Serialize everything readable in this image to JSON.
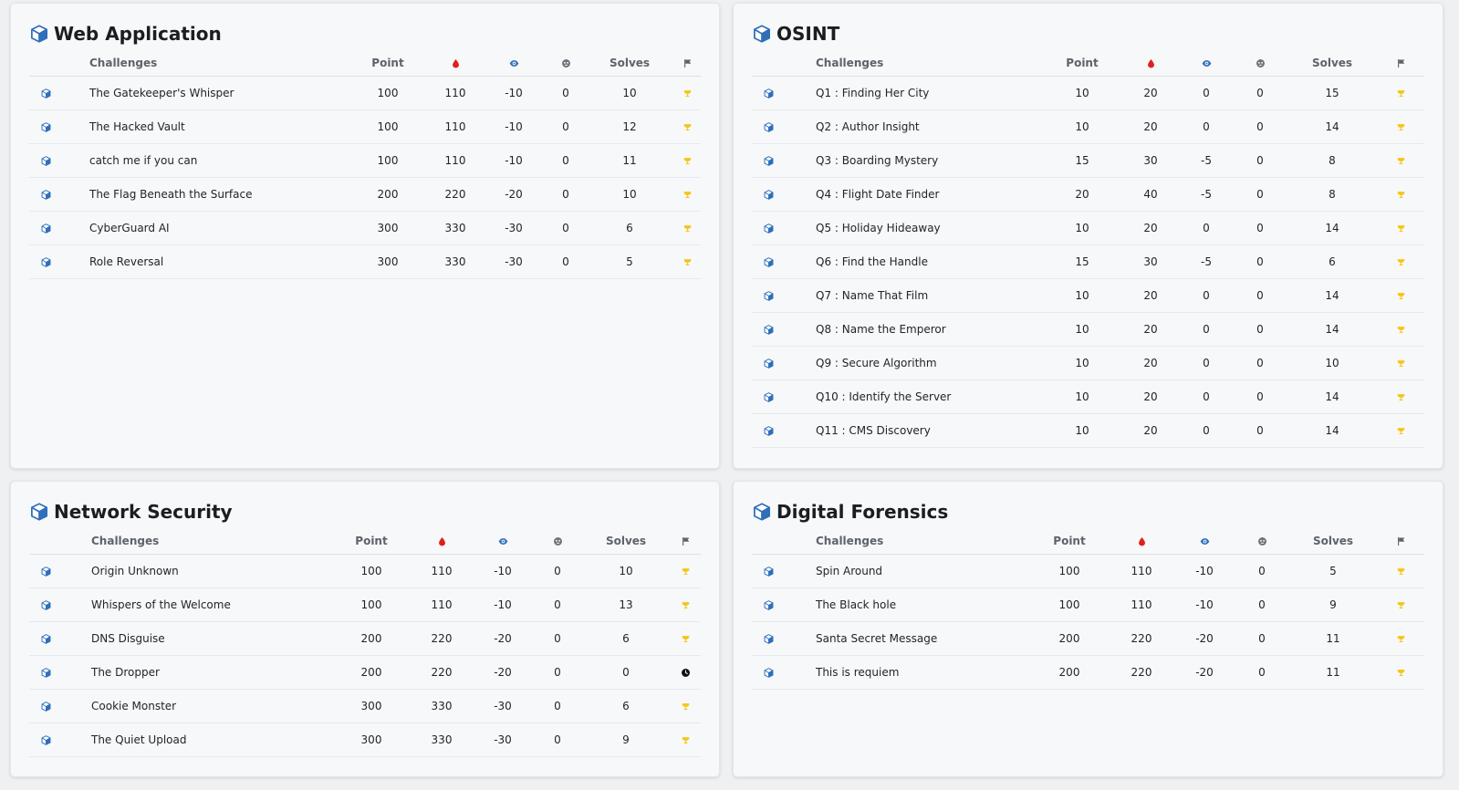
{
  "colors": {
    "cube": "#2f6fba",
    "blood": "#e0201c",
    "eye": "#2f6fba",
    "ghost": "#6c757d",
    "flag": "#5c636a",
    "trophy": "#f5c518",
    "clock": "#111111"
  },
  "columns": {
    "challenges": "Challenges",
    "point": "Point",
    "first_blood_icon": "blood-drop-icon",
    "hint_icon": "eye-icon",
    "ghost_icon": "ghost-icon",
    "solves": "Solves",
    "status_icon": "flag-icon"
  },
  "categories": [
    {
      "title": "Web Application",
      "icon": "cube-icon",
      "rows": [
        {
          "name": "The Gatekeeper's Whisper",
          "point": "100",
          "blood": "110",
          "hint": "-10",
          "ghost": "0",
          "solves": "10",
          "status": "trophy-icon"
        },
        {
          "name": "The Hacked Vault",
          "point": "100",
          "blood": "110",
          "hint": "-10",
          "ghost": "0",
          "solves": "12",
          "status": "trophy-icon"
        },
        {
          "name": "catch me if you can",
          "point": "100",
          "blood": "110",
          "hint": "-10",
          "ghost": "0",
          "solves": "11",
          "status": "trophy-icon"
        },
        {
          "name": "The Flag Beneath the Surface",
          "point": "200",
          "blood": "220",
          "hint": "-20",
          "ghost": "0",
          "solves": "10",
          "status": "trophy-icon"
        },
        {
          "name": "CyberGuard AI",
          "point": "300",
          "blood": "330",
          "hint": "-30",
          "ghost": "0",
          "solves": "6",
          "status": "trophy-icon"
        },
        {
          "name": "Role Reversal",
          "point": "300",
          "blood": "330",
          "hint": "-30",
          "ghost": "0",
          "solves": "5",
          "status": "trophy-icon"
        }
      ]
    },
    {
      "title": "OSINT",
      "icon": "cube-icon",
      "rows": [
        {
          "name": "Q1 : Finding Her City",
          "point": "10",
          "blood": "20",
          "hint": "0",
          "ghost": "0",
          "solves": "15",
          "status": "trophy-icon"
        },
        {
          "name": "Q2 : Author Insight",
          "point": "10",
          "blood": "20",
          "hint": "0",
          "ghost": "0",
          "solves": "14",
          "status": "trophy-icon"
        },
        {
          "name": "Q3 : Boarding Mystery",
          "point": "15",
          "blood": "30",
          "hint": "-5",
          "ghost": "0",
          "solves": "8",
          "status": "trophy-icon"
        },
        {
          "name": "Q4 : Flight Date Finder",
          "point": "20",
          "blood": "40",
          "hint": "-5",
          "ghost": "0",
          "solves": "8",
          "status": "trophy-icon"
        },
        {
          "name": "Q5 : Holiday Hideaway",
          "point": "10",
          "blood": "20",
          "hint": "0",
          "ghost": "0",
          "solves": "14",
          "status": "trophy-icon"
        },
        {
          "name": "Q6 : Find the Handle",
          "point": "15",
          "blood": "30",
          "hint": "-5",
          "ghost": "0",
          "solves": "6",
          "status": "trophy-icon"
        },
        {
          "name": "Q7 : Name That Film",
          "point": "10",
          "blood": "20",
          "hint": "0",
          "ghost": "0",
          "solves": "14",
          "status": "trophy-icon"
        },
        {
          "name": "Q8 : Name the Emperor",
          "point": "10",
          "blood": "20",
          "hint": "0",
          "ghost": "0",
          "solves": "14",
          "status": "trophy-icon"
        },
        {
          "name": "Q9 : Secure Algorithm",
          "point": "10",
          "blood": "20",
          "hint": "0",
          "ghost": "0",
          "solves": "10",
          "status": "trophy-icon"
        },
        {
          "name": "Q10 : Identify the Server",
          "point": "10",
          "blood": "20",
          "hint": "0",
          "ghost": "0",
          "solves": "14",
          "status": "trophy-icon"
        },
        {
          "name": "Q11 : CMS Discovery",
          "point": "10",
          "blood": "20",
          "hint": "0",
          "ghost": "0",
          "solves": "14",
          "status": "trophy-icon"
        }
      ]
    },
    {
      "title": "Network Security",
      "icon": "cube-icon",
      "rows": [
        {
          "name": "Origin Unknown",
          "point": "100",
          "blood": "110",
          "hint": "-10",
          "ghost": "0",
          "solves": "10",
          "status": "trophy-icon"
        },
        {
          "name": "Whispers of the Welcome",
          "point": "100",
          "blood": "110",
          "hint": "-10",
          "ghost": "0",
          "solves": "13",
          "status": "trophy-icon"
        },
        {
          "name": "DNS Disguise",
          "point": "200",
          "blood": "220",
          "hint": "-20",
          "ghost": "0",
          "solves": "6",
          "status": "trophy-icon"
        },
        {
          "name": "The Dropper",
          "point": "200",
          "blood": "220",
          "hint": "-20",
          "ghost": "0",
          "solves": "0",
          "status": "clock-icon"
        },
        {
          "name": "Cookie Monster",
          "point": "300",
          "blood": "330",
          "hint": "-30",
          "ghost": "0",
          "solves": "6",
          "status": "trophy-icon"
        },
        {
          "name": "The Quiet Upload",
          "point": "300",
          "blood": "330",
          "hint": "-30",
          "ghost": "0",
          "solves": "9",
          "status": "trophy-icon"
        }
      ]
    },
    {
      "title": "Digital Forensics",
      "icon": "cube-icon",
      "rows": [
        {
          "name": "Spin Around",
          "point": "100",
          "blood": "110",
          "hint": "-10",
          "ghost": "0",
          "solves": "5",
          "status": "trophy-icon"
        },
        {
          "name": "The Black hole",
          "point": "100",
          "blood": "110",
          "hint": "-10",
          "ghost": "0",
          "solves": "9",
          "status": "trophy-icon"
        },
        {
          "name": "Santa Secret Message",
          "point": "200",
          "blood": "220",
          "hint": "-20",
          "ghost": "0",
          "solves": "11",
          "status": "trophy-icon"
        },
        {
          "name": "This is requiem",
          "point": "200",
          "blood": "220",
          "hint": "-20",
          "ghost": "0",
          "solves": "11",
          "status": "trophy-icon"
        }
      ]
    }
  ]
}
